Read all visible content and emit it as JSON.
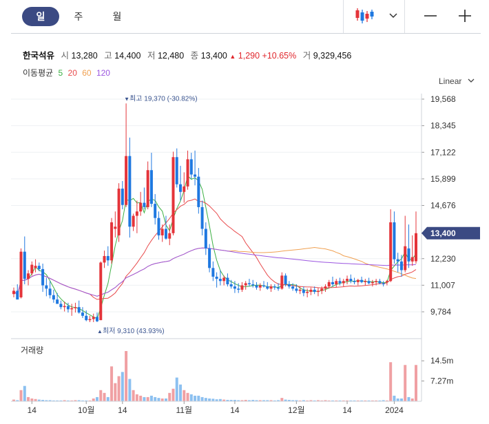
{
  "toolbar": {
    "tabs": [
      {
        "label": "일",
        "active": true
      },
      {
        "label": "주",
        "active": false
      },
      {
        "label": "월",
        "active": false
      }
    ],
    "chart_type_icon": "candlestick-icon",
    "dropdown_icon": "chevron-down-icon",
    "zoom_out_icon": "minus-icon",
    "zoom_in_icon": "plus-icon"
  },
  "quote": {
    "name": "한국석유",
    "open_label": "시",
    "open": "13,280",
    "high_label": "고",
    "high": "14,400",
    "low_label": "저",
    "low": "12,480",
    "close_label": "종",
    "close": "13,400",
    "change": "1,290",
    "change_pct": "+10.65%",
    "volume_label": "거",
    "volume": "9,329,456"
  },
  "ma": {
    "label": "이동평균",
    "periods": [
      "5",
      "20",
      "60",
      "120"
    ],
    "colors": {
      "5": "#3cb043",
      "20": "#e8494b",
      "60": "#f0a050",
      "120": "#9b55e0"
    }
  },
  "scale": {
    "label": "Linear"
  },
  "colors": {
    "up": "#e4343a",
    "down": "#1f78e0",
    "up_vol": "#f0a0a3",
    "down_vol": "#8cc0f0",
    "accent": "#3b4a83"
  },
  "chart_data": {
    "type": "candlestick",
    "price_axis_ticks": [
      "19,568",
      "18,345",
      "17,122",
      "15,899",
      "14,676",
      "12,230",
      "11,007",
      "9,784"
    ],
    "price_axis_values": [
      19568,
      18345,
      17122,
      15899,
      14676,
      12230,
      11007,
      9784
    ],
    "current_price_label": "13,400",
    "current_price": 13400,
    "high_annotation": "최고 19,370 (-30.82%)",
    "high_value": 19370,
    "high_index": 31,
    "low_annotation": "최저 9,310 (43.93%)",
    "low_value": 9310,
    "low_index": 23,
    "ylim": [
      9300,
      19900
    ],
    "x_ticks": [
      {
        "label": "14",
        "index": 5
      },
      {
        "label": "10월",
        "index": 20
      },
      {
        "label": "14",
        "index": 30
      },
      {
        "label": "11월",
        "index": 47
      },
      {
        "label": "14",
        "index": 61
      },
      {
        "label": "12월",
        "index": 78
      },
      {
        "label": "14",
        "index": 92
      },
      {
        "label": "2024",
        "index": 105
      }
    ],
    "volume_title": "거래량",
    "volume_axis_ticks": [
      "14.5m",
      "7.27m"
    ],
    "volume_axis_values": [
      14.5,
      7.27
    ],
    "volume_max": 18.0,
    "candles": [
      [
        10600,
        10900,
        10450,
        10750,
        0.6
      ],
      [
        10750,
        11050,
        10500,
        10350,
        0.4
      ],
      [
        10450,
        12700,
        10400,
        12550,
        4.0
      ],
      [
        12550,
        13250,
        11050,
        11300,
        5.5
      ],
      [
        11300,
        11700,
        11000,
        11550,
        1.5
      ],
      [
        11550,
        12100,
        11450,
        11950,
        1.0
      ],
      [
        11800,
        12200,
        11600,
        11900,
        0.8
      ],
      [
        11900,
        12050,
        11650,
        11750,
        0.6
      ],
      [
        11750,
        12000,
        10700,
        11000,
        0.5
      ],
      [
        11000,
        11350,
        10500,
        10850,
        0.4
      ],
      [
        10850,
        11200,
        10400,
        10550,
        0.4
      ],
      [
        10550,
        10800,
        10200,
        10350,
        0.3
      ],
      [
        10350,
        10650,
        10150,
        10150,
        0.3
      ],
      [
        10150,
        10300,
        9900,
        10000,
        0.3
      ],
      [
        10000,
        10250,
        9800,
        10050,
        0.4
      ],
      [
        10050,
        10200,
        9750,
        9900,
        0.3
      ],
      [
        9900,
        10150,
        9600,
        9950,
        0.3
      ],
      [
        9950,
        10200,
        9750,
        10000,
        0.4
      ],
      [
        10000,
        10300,
        9700,
        9750,
        0.4
      ],
      [
        9750,
        10000,
        9500,
        9600,
        0.3
      ],
      [
        9600,
        9850,
        9350,
        9400,
        0.3
      ],
      [
        9400,
        9600,
        9310,
        9450,
        0.3
      ],
      [
        9450,
        9700,
        9310,
        9550,
        1.0
      ],
      [
        9550,
        9750,
        9310,
        9350,
        1.5
      ],
      [
        9400,
        12100,
        9400,
        12050,
        4.0
      ],
      [
        12050,
        12600,
        11800,
        12350,
        3.0
      ],
      [
        12350,
        12800,
        11900,
        12150,
        1.5
      ],
      [
        12150,
        14100,
        12000,
        13900,
        12.5
      ],
      [
        13600,
        14400,
        13200,
        13700,
        6.5
      ],
      [
        13300,
        15700,
        13000,
        15450,
        9.0
      ],
      [
        15450,
        15800,
        14500,
        14700,
        10.5
      ],
      [
        14700,
        19370,
        14600,
        16950,
        18.0
      ],
      [
        16950,
        17800,
        13200,
        13700,
        8.0
      ],
      [
        13700,
        14300,
        13500,
        14200,
        4.0
      ],
      [
        14200,
        14900,
        13400,
        14400,
        2.5
      ],
      [
        14400,
        15300,
        14200,
        14800,
        2.0
      ],
      [
        14800,
        15500,
        14500,
        14600,
        1.5
      ],
      [
        14600,
        16700,
        14500,
        16300,
        1.5
      ],
      [
        16300,
        17100,
        14600,
        14750,
        2.0
      ],
      [
        14750,
        15200,
        13800,
        14100,
        1.5
      ],
      [
        14100,
        14400,
        13100,
        13300,
        1.2
      ],
      [
        13300,
        13800,
        13000,
        13600,
        1.0
      ],
      [
        13600,
        14200,
        13100,
        13150,
        1.0
      ],
      [
        13150,
        13800,
        12850,
        13400,
        3.0
      ],
      [
        13400,
        17150,
        13300,
        16900,
        4.5
      ],
      [
        16900,
        17300,
        15500,
        15650,
        8.5
      ],
      [
        15650,
        16500,
        14900,
        15300,
        6.0
      ],
      [
        15300,
        16200,
        14800,
        15550,
        4.0
      ],
      [
        15550,
        17200,
        15400,
        16800,
        3.0
      ],
      [
        16800,
        17100,
        15900,
        16100,
        2.5
      ],
      [
        16100,
        17200,
        15600,
        16000,
        2.0
      ],
      [
        16000,
        16400,
        14300,
        14600,
        2.0
      ],
      [
        14600,
        14900,
        13300,
        13600,
        1.5
      ],
      [
        13600,
        13900,
        12400,
        12700,
        1.2
      ],
      [
        12700,
        12900,
        11600,
        11800,
        1.0
      ],
      [
        11800,
        12100,
        11200,
        11400,
        0.9
      ],
      [
        11400,
        11600,
        10900,
        11300,
        0.7
      ],
      [
        11300,
        11700,
        11000,
        11200,
        0.8
      ],
      [
        11200,
        11450,
        11000,
        11350,
        0.6
      ],
      [
        11350,
        11550,
        10950,
        11050,
        0.5
      ],
      [
        11050,
        11250,
        10850,
        10950,
        0.5
      ],
      [
        10950,
        11200,
        10650,
        10850,
        0.5
      ],
      [
        10850,
        11100,
        10650,
        10800,
        0.4
      ],
      [
        10800,
        11150,
        10700,
        11000,
        0.4
      ],
      [
        11000,
        11200,
        10800,
        11100,
        0.5
      ],
      [
        11100,
        11300,
        10950,
        11050,
        0.4
      ],
      [
        11050,
        11250,
        10900,
        11000,
        0.5
      ],
      [
        11000,
        11150,
        10800,
        10900,
        0.4
      ],
      [
        10900,
        11100,
        10750,
        11000,
        0.4
      ],
      [
        11000,
        11200,
        10900,
        10950,
        0.4
      ],
      [
        10950,
        11150,
        10800,
        10850,
        0.4
      ],
      [
        10850,
        11050,
        10700,
        10950,
        0.4
      ],
      [
        10950,
        11050,
        10800,
        10900,
        0.3
      ],
      [
        10900,
        11100,
        10750,
        10850,
        0.4
      ],
      [
        10850,
        11600,
        10800,
        11450,
        1.2
      ],
      [
        11450,
        11550,
        10950,
        11050,
        0.6
      ],
      [
        11050,
        11200,
        10850,
        10950,
        0.5
      ],
      [
        10950,
        11100,
        10750,
        10850,
        0.4
      ],
      [
        10850,
        11050,
        10650,
        10750,
        0.4
      ],
      [
        10750,
        10950,
        10600,
        10800,
        0.3
      ],
      [
        10800,
        10950,
        10500,
        10650,
        0.4
      ],
      [
        10650,
        10850,
        10450,
        10700,
        0.3
      ],
      [
        10700,
        10900,
        10550,
        10800,
        0.4
      ],
      [
        10800,
        10950,
        10600,
        10700,
        0.3
      ],
      [
        10700,
        10900,
        10500,
        10750,
        0.4
      ],
      [
        10750,
        10950,
        10600,
        10850,
        0.3
      ],
      [
        10850,
        11050,
        10700,
        10950,
        0.4
      ],
      [
        10950,
        11250,
        10850,
        11150,
        0.3
      ],
      [
        11150,
        11400,
        10950,
        11050,
        0.3
      ],
      [
        11050,
        11300,
        10900,
        11200,
        0.3
      ],
      [
        11200,
        11350,
        11000,
        11100,
        0.3
      ],
      [
        11100,
        11300,
        10950,
        11200,
        0.3
      ],
      [
        11200,
        11450,
        11050,
        11300,
        0.3
      ],
      [
        11300,
        11500,
        11100,
        11200,
        0.3
      ],
      [
        11200,
        11350,
        11050,
        11150,
        0.3
      ],
      [
        11150,
        11300,
        11000,
        11250,
        0.3
      ],
      [
        11250,
        11400,
        11100,
        11150,
        0.3
      ],
      [
        11150,
        11300,
        11000,
        11200,
        0.3
      ],
      [
        11200,
        11350,
        11050,
        11100,
        0.3
      ],
      [
        11100,
        11250,
        10950,
        11150,
        0.3
      ],
      [
        11150,
        11300,
        11000,
        11200,
        0.3
      ],
      [
        11200,
        11300,
        11050,
        11100,
        0.3
      ],
      [
        11100,
        11200,
        10950,
        11050,
        0.4
      ],
      [
        11150,
        11250,
        11000,
        11200,
        0.3
      ],
      [
        11200,
        14500,
        11150,
        13900,
        14.0
      ],
      [
        13900,
        14400,
        12000,
        12200,
        2.0
      ],
      [
        12200,
        12500,
        11600,
        12100,
        1.0
      ],
      [
        12100,
        12400,
        11400,
        11700,
        1.0
      ],
      [
        11700,
        14200,
        11600,
        12800,
        13.0
      ],
      [
        12700,
        13800,
        11800,
        12100,
        1.5
      ],
      [
        12100,
        13300,
        11900,
        12300,
        1.0
      ],
      [
        12110,
        14400,
        12000,
        13400,
        13.0
      ]
    ]
  }
}
